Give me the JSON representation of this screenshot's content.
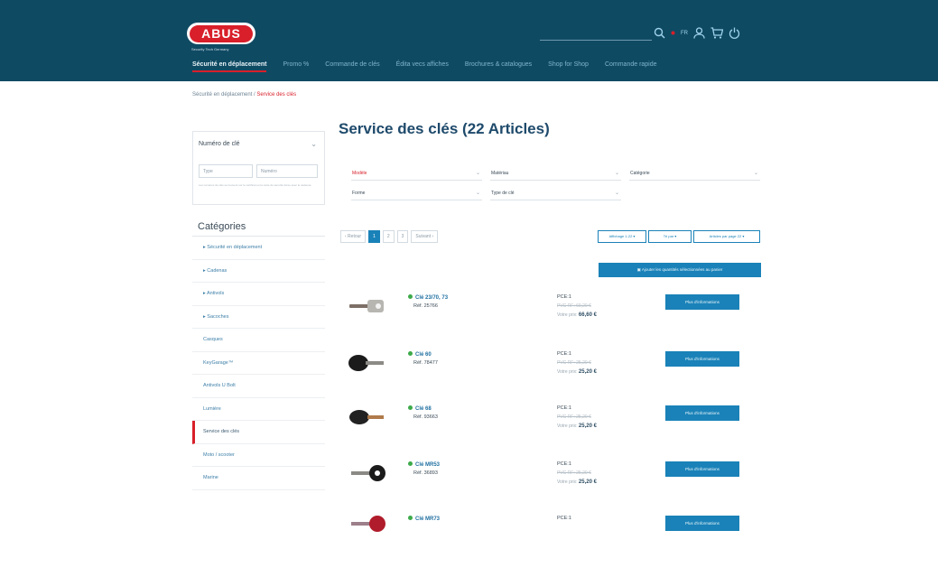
{
  "header": {
    "logo": "ABUS",
    "tagline": "Security Tech Germany",
    "lang": "FR",
    "nav": [
      "Sécurité en déplacement",
      "Promo %",
      "Commande de clés",
      "Édita vecs affiches",
      "Brochures & catalogues",
      "Shop for Shop",
      "Commande rapide"
    ]
  },
  "breadcrumb": {
    "parent": "Sécurité en déplacement",
    "sep": "/",
    "current": "Service des clés"
  },
  "sidebar": {
    "key_box": {
      "title": "Numéro de clé",
      "type_placeholder": "Type",
      "number_placeholder": "Numéro",
      "hint": "Les numéros de clés se trouvent sur le certificat ou la carte de sécurité livrée avec le cadenas."
    },
    "categories_title": "Catégories",
    "categories": [
      {
        "label": "▸ Sécurité en déplacement"
      },
      {
        "label": "▸ Cadenas"
      },
      {
        "label": "▸ Antivols"
      },
      {
        "label": "▸ Sacoches"
      },
      {
        "label": "Casques"
      },
      {
        "label": "KeyGarage™"
      },
      {
        "label": "Antivols U Bolt"
      },
      {
        "label": "Lumière"
      },
      {
        "label": "Service des clés"
      },
      {
        "label": "Moto / scooter"
      },
      {
        "label": "Marine"
      }
    ]
  },
  "main": {
    "title": "Service des clés (22 Articles)",
    "filters": [
      "Modèle",
      "Matériau",
      "Catégorie",
      "Forme",
      "Type de clé"
    ],
    "pager": {
      "prev": "‹ Retour",
      "pages": [
        "1",
        "2",
        "3"
      ],
      "next": "Suivant ›"
    },
    "sort": [
      "Affichage 1-22 ▾",
      "Tri par ▾",
      "Articles par page 22 ▾"
    ],
    "cart_button": "▣ Ajouter les quantités sélectionnées au panier",
    "products": [
      {
        "name": "Clé 23/70, 73",
        "art": "Réf. 25766",
        "pce": "PCE:1",
        "old": "PVC RF: 69,20 €",
        "price_label": "Votre prix:",
        "price": "66,60 €",
        "button": "Plus d'informations"
      },
      {
        "name": "Clé 60",
        "art": "Réf. 78477",
        "pce": "PCE:1",
        "old": "PVC RF: 25,20 €",
        "price_label": "Votre prix:",
        "price": "25,20 €",
        "button": "Plus d'informations"
      },
      {
        "name": "Clé 68",
        "art": "Réf. 93663",
        "pce": "PCE:1",
        "old": "PVC RF: 25,20 €",
        "price_label": "Votre prix:",
        "price": "25,20 €",
        "button": "Plus d'informations"
      },
      {
        "name": "Clé MR53",
        "art": "Réf. 36893",
        "pce": "PCE:1",
        "old": "PVC RF: 25,20 €",
        "price_label": "Votre prix:",
        "price": "25,20 €",
        "button": "Plus d'informations"
      },
      {
        "name": "Clé MR73",
        "art": "",
        "pce": "PCE:1",
        "old": "",
        "price_label": "",
        "price": "",
        "button": "Plus d'informations"
      }
    ]
  },
  "colors": {
    "header_bg": "#0f4a63",
    "brand_red": "#d81f2a",
    "accent_blue": "#1a82b8",
    "stock_green": "#3daa4a"
  },
  "icons": [
    "search-icon",
    "user-icon",
    "cart-icon",
    "power-icon"
  ]
}
